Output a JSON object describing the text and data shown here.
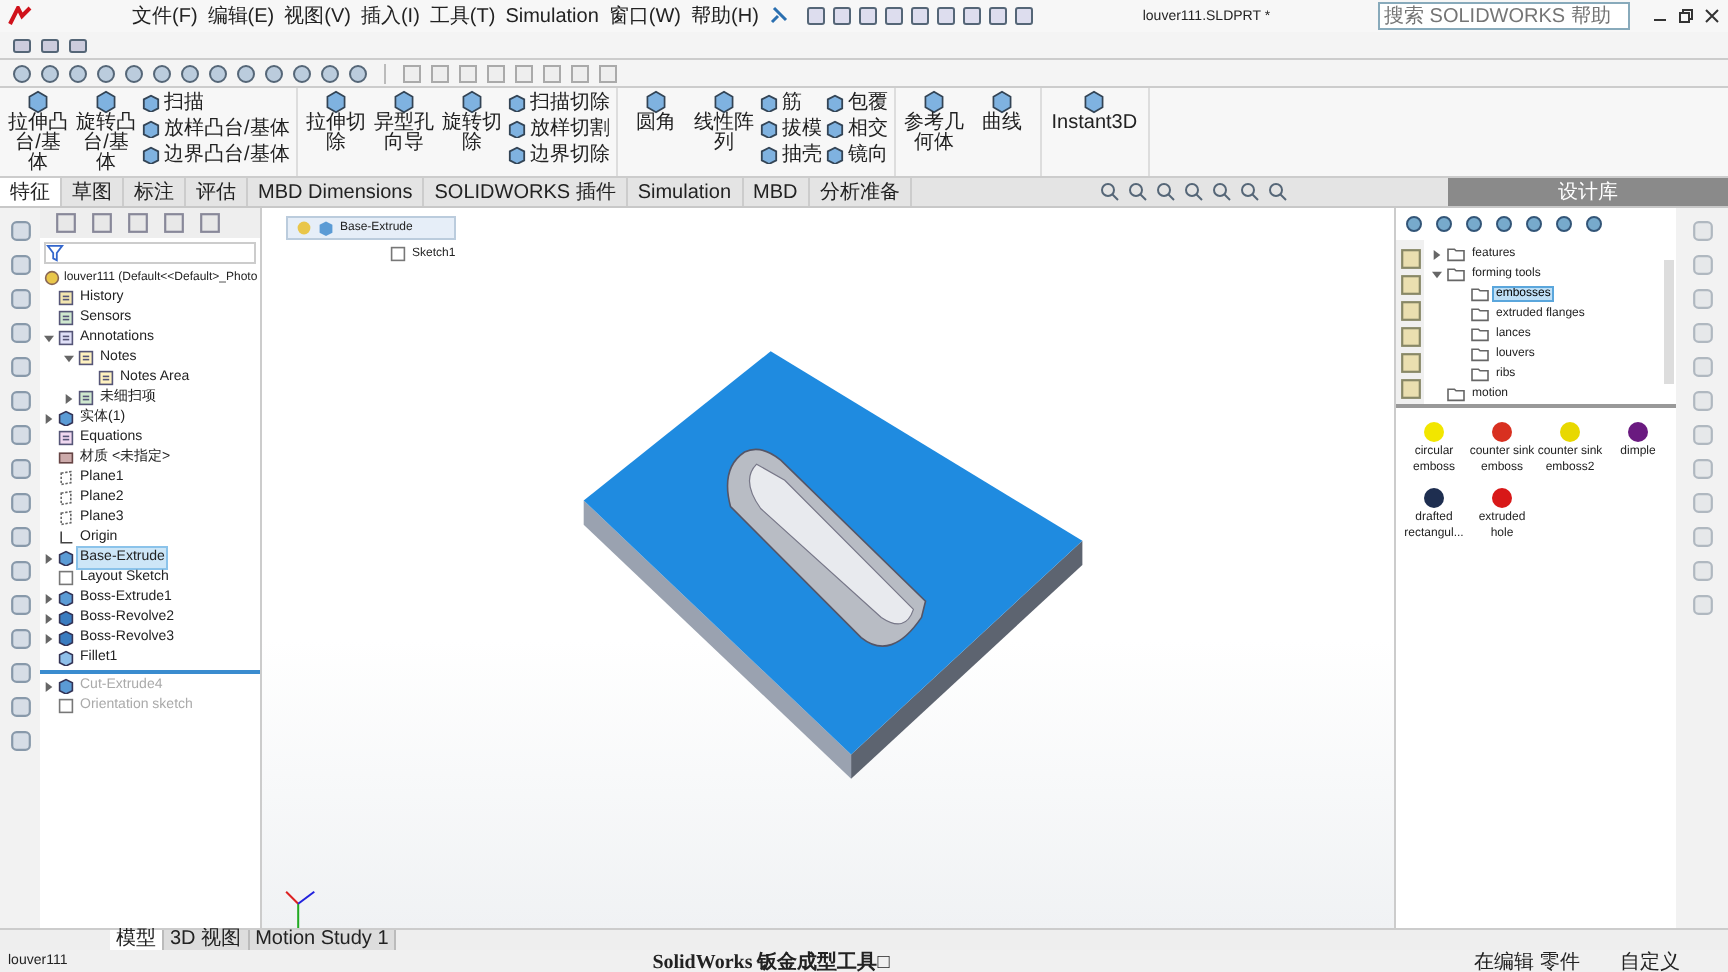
{
  "title_bar": {
    "menus": [
      "文件(F)",
      "编辑(E)",
      "视图(V)",
      "插入(I)",
      "工具(T)",
      "Simulation",
      "窗口(W)",
      "帮助(H)"
    ],
    "document_title": "louver111.SLDPRT *",
    "search": {
      "placeholder": "搜索 SOLIDWORKS 帮助"
    }
  },
  "ribbon": {
    "groups": [
      {
        "items": [
          {
            "kind": "large",
            "label": "拉伸凸台/基体"
          },
          {
            "kind": "large",
            "label": "旋转凸台/基体"
          },
          {
            "kind": "stack",
            "labels": [
              "扫描",
              "放样凸台/基体",
              "边界凸台/基体"
            ]
          }
        ]
      },
      {
        "items": [
          {
            "kind": "large",
            "label": "拉伸切除"
          },
          {
            "kind": "large",
            "label": "异型孔向导"
          },
          {
            "kind": "large",
            "label": "旋转切除"
          },
          {
            "kind": "stack",
            "labels": [
              "扫描切除",
              "放样切割",
              "边界切除"
            ]
          }
        ]
      },
      {
        "items": [
          {
            "kind": "large",
            "label": "圆角"
          },
          {
            "kind": "large",
            "label": "线性阵列"
          },
          {
            "kind": "stack",
            "labels": [
              "筋",
              "拔模",
              "抽壳"
            ]
          },
          {
            "kind": "stack",
            "labels": [
              "包覆",
              "相交",
              "镜向"
            ]
          }
        ]
      },
      {
        "items": [
          {
            "kind": "large",
            "label": "参考几何体"
          },
          {
            "kind": "large",
            "label": "曲线"
          }
        ]
      },
      {
        "items": [
          {
            "kind": "large",
            "label": "Instant3D"
          }
        ]
      }
    ]
  },
  "command_tabs": [
    {
      "label": "特征",
      "selected": true
    },
    {
      "label": "草图",
      "selected": false
    },
    {
      "label": "标注",
      "selected": false
    },
    {
      "label": "评估",
      "selected": false
    },
    {
      "label": "MBD Dimensions",
      "selected": false
    },
    {
      "label": "SOLIDWORKS 插件",
      "selected": false
    },
    {
      "label": "Simulation",
      "selected": false
    },
    {
      "label": "MBD",
      "selected": false
    },
    {
      "label": "分析准备",
      "selected": false
    }
  ],
  "feature_tree": {
    "root": "louver111  (Default<<Default>_Photo",
    "items": [
      {
        "label": "History",
        "kind": "history",
        "selected": false,
        "disabled": false
      },
      {
        "label": "Sensors",
        "kind": "sensor",
        "selected": false,
        "disabled": false
      },
      {
        "label": "Annotations",
        "kind": "annotation",
        "expanded": true,
        "selected": false,
        "disabled": false,
        "children": [
          {
            "label": "Notes",
            "kind": "note",
            "expanded": true,
            "selected": false,
            "disabled": false,
            "children": [
              {
                "label": "Notes Area",
                "kind": "note",
                "selected": false,
                "disabled": false
              }
            ]
          },
          {
            "label": "未细扫项",
            "kind": "sensor",
            "expanded": false,
            "selected": false,
            "disabled": false
          }
        ]
      },
      {
        "label": "实体(1)",
        "kind": "solid",
        "expanded": false,
        "selected": false,
        "disabled": false
      },
      {
        "label": "Equations",
        "kind": "equation",
        "selected": false,
        "disabled": false
      },
      {
        "label": "材质 <未指定>",
        "kind": "material",
        "selected": false,
        "disabled": false
      },
      {
        "label": "Plane1",
        "kind": "plane",
        "selected": false,
        "disabled": false
      },
      {
        "label": "Plane2",
        "kind": "plane",
        "selected": false,
        "disabled": false
      },
      {
        "label": "Plane3",
        "kind": "plane",
        "selected": false,
        "disabled": false
      },
      {
        "label": "Origin",
        "kind": "origin",
        "selected": false,
        "disabled": false
      },
      {
        "label": "Base-Extrude",
        "kind": "extrude",
        "expanded": false,
        "selected": true,
        "disabled": false
      },
      {
        "label": "Layout Sketch",
        "kind": "sketch",
        "selected": false,
        "disabled": false
      },
      {
        "label": "Boss-Extrude1",
        "kind": "extrude",
        "expanded": false,
        "selected": false,
        "disabled": false
      },
      {
        "label": "Boss-Revolve2",
        "kind": "revolve",
        "expanded": false,
        "selected": false,
        "disabled": false
      },
      {
        "label": "Boss-Revolve3",
        "kind": "revolve",
        "expanded": false,
        "selected": false,
        "disabled": false
      },
      {
        "label": "Fillet1",
        "kind": "fillet",
        "selected": false,
        "disabled": false
      },
      {
        "label": "Cut-Extrude4",
        "kind": "extrude",
        "expanded": false,
        "selected": false,
        "disabled": true
      },
      {
        "label": "Orientation sketch",
        "kind": "sketch",
        "selected": false,
        "disabled": true
      }
    ]
  },
  "breadcrumb": {
    "feature": "Base-Extrude",
    "sketch": "Sketch1"
  },
  "design_library": {
    "title": "设计库",
    "folders": [
      {
        "label": "features",
        "expanded": false,
        "selected": false
      },
      {
        "label": "forming tools",
        "expanded": true,
        "selected": false,
        "children": [
          {
            "label": "embosses",
            "selected": true
          },
          {
            "label": "extruded flanges",
            "selected": false
          },
          {
            "label": "lances",
            "selected": false
          },
          {
            "label": "louvers",
            "selected": false
          },
          {
            "label": "ribs",
            "selected": false
          }
        ]
      },
      {
        "label": "motion",
        "selected": false
      }
    ],
    "items": [
      {
        "label": "circular emboss",
        "color": "#f2e600"
      },
      {
        "label": "counter sink emboss",
        "color": "#d83020"
      },
      {
        "label": "counter sink emboss2",
        "color": "#e8d800"
      },
      {
        "label": "dimple",
        "color": "#6a1a80"
      },
      {
        "label": "drafted rectangul...",
        "color": "#1e2e50"
      },
      {
        "label": "extruded hole",
        "color": "#d81818"
      }
    ]
  },
  "bottom_tabs": [
    {
      "label": "模型",
      "selected": true
    },
    {
      "label": "3D 视图",
      "selected": false
    },
    {
      "label": "Motion Study 1",
      "selected": false
    }
  ],
  "status_bar": {
    "document": "louver111",
    "caption": "SolidWorks 钣金成型工具□",
    "mode": "在编辑 零件",
    "units": "自定义"
  }
}
